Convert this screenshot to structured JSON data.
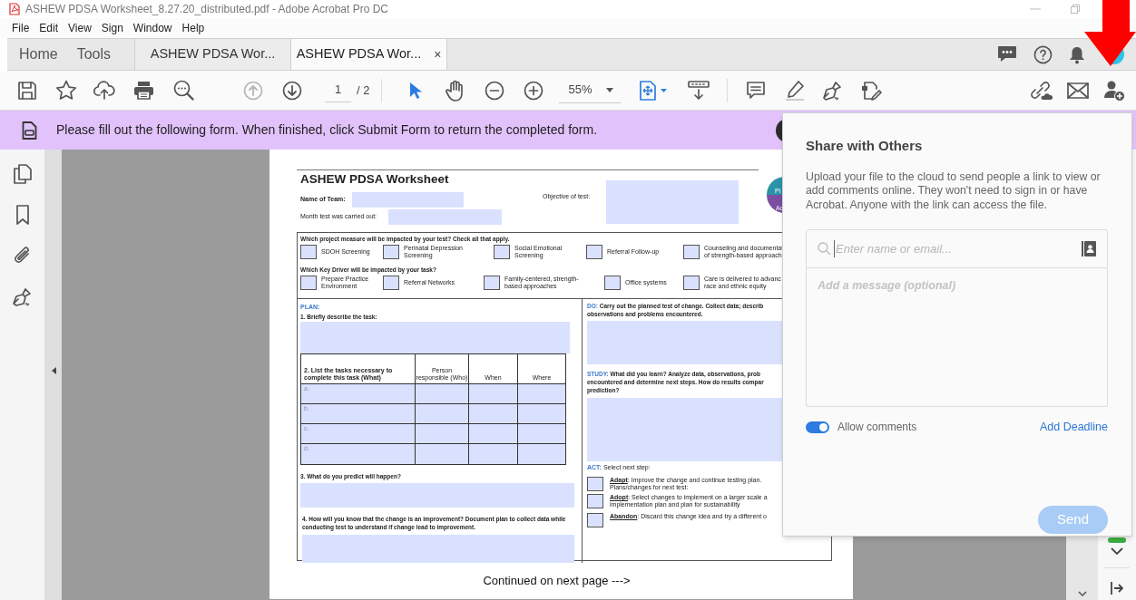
{
  "window": {
    "title": "ASHEW PDSA Worksheet_8.27.20_distributed.pdf - Adobe Acrobat Pro DC"
  },
  "menu": [
    "File",
    "Edit",
    "View",
    "Sign",
    "Window",
    "Help"
  ],
  "nav_tabs": [
    {
      "label": "Home",
      "selected": false
    },
    {
      "label": "Tools",
      "selected": false
    }
  ],
  "doc_tabs": [
    {
      "label": "ASHEW PDSA Wor...",
      "selected": false
    },
    {
      "label": "ASHEW PDSA Wor...",
      "selected": true,
      "close": "×"
    }
  ],
  "toolbar": {
    "page_nav": [
      {
        "kind": "up",
        "disabled": true
      },
      {
        "kind": "down",
        "disabled": false
      }
    ],
    "page_current": "1",
    "page_total": "/ 2",
    "zoom": "55%"
  },
  "banner": {
    "text": "Please fill out the following form. When finished, click Submit Form to return the completed form."
  },
  "document": {
    "title": "ASHEW PDSA Worksheet",
    "team_label": "Name of Team:",
    "month_label": "Month test was carried out:",
    "objective_label": "Objective of test:",
    "cycle_labels": [
      "Pl",
      "Ac"
    ],
    "checkbox_groups": [
      {
        "question": "Which project measure will be impacted by your test? Check all that apply.",
        "options": [
          {
            "lines": [
              "SDOH Screening"
            ],
            "checked": false
          },
          {
            "lines": [
              "Perinatal Depression",
              "Screening"
            ],
            "checked": false
          },
          {
            "lines": [
              "Social Emotional",
              "Screening"
            ],
            "checked": false
          },
          {
            "lines": [
              "Referral Follow-up"
            ],
            "checked": false
          },
          {
            "lines": [
              "Counseling and documentat",
              "of strength-based approach"
            ],
            "checked": false
          }
        ]
      },
      {
        "question": "Which Key Driver will be impacted by your task?",
        "options": [
          {
            "lines": [
              "Prepare Practice",
              "Environment"
            ],
            "checked": false
          },
          {
            "lines": [
              "Referral Networks"
            ],
            "checked": false
          },
          {
            "lines": [
              "Family-centered, strength-",
              "based approaches"
            ],
            "checked": false
          },
          {
            "lines": [
              "Office systems"
            ],
            "checked": false
          },
          {
            "lines": [
              "Care is delivered to advanc",
              "race and ethnic equity"
            ],
            "checked": false
          }
        ]
      }
    ],
    "plan": {
      "heading": "PLAN:",
      "task_prompt": "1. Briefly describe the task:",
      "table": {
        "columns": [
          "2. List the tasks necessary to complete this task (What)",
          "Person responsible (Who)",
          "When",
          "Where"
        ],
        "rows": [
          "a.",
          "b.",
          "c.",
          "d."
        ]
      },
      "predict_prompt": "3. What do you predict will happen?",
      "measure_prompt": "4. How will you know that the change is an improvement? Document plan to collect data while conducting test to understand if change lead to improvement."
    },
    "do": {
      "heading": "DO:",
      "lines": [
        "Carry out the planned test of change. Collect data; describ",
        "observations and problems encountered."
      ]
    },
    "study": {
      "heading": "STUDY:",
      "lines": [
        "What did you learn? Analyze data, observations, prob",
        "encountered and determine next steps. How do results compar",
        "prediction?"
      ]
    },
    "act": {
      "heading": "ACT:",
      "prompt": "Select next step:",
      "options": [
        {
          "term": "Adapt",
          "lines": [
            ": Improve the change and continue testing plan.",
            "Plans/changes for next test:"
          ],
          "checked": false
        },
        {
          "term": "Adopt",
          "lines": [
            ": Select changes to implement on a larger scale a",
            "implementation plan and plan for sustainability"
          ],
          "checked": false
        },
        {
          "term": "Abandon",
          "lines": [
            ": Discard this change idea and try a different o"
          ],
          "checked": false
        }
      ]
    }
  },
  "continued": "Continued on next page --->",
  "share_panel": {
    "title": "Share with Others",
    "description": "Upload your file to the cloud to send people a link to view or add comments online. They won't need to sign in or have Acrobat. Anyone with the link can access the file.",
    "recipient_placeholder": "Enter name or email...",
    "message_placeholder": "Add a message (optional)",
    "allow_comments": {
      "label": "Allow comments",
      "on": true
    },
    "deadline_link": "Add Deadline",
    "send_button": {
      "label": "Send",
      "disabled": true
    }
  }
}
